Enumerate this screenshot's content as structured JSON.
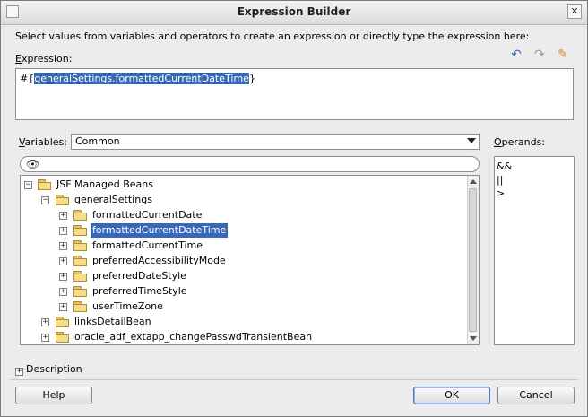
{
  "window": {
    "title": "Expression Builder"
  },
  "instructions": "Select values from variables and operators to create an expression or directly type the expression here:",
  "toolbar": {
    "undo_icon": "undo-icon",
    "redo_icon": "redo-icon",
    "clear_icon": "eraser-icon"
  },
  "expression": {
    "label_mnemonic": "E",
    "label_rest": "xpression:",
    "prefix": "#{",
    "selected": "generalSettings.formattedCurrentDateTime",
    "suffix": "}"
  },
  "variables": {
    "label_mnemonic": "V",
    "label_rest": "ariables:",
    "selected": "Common",
    "search_placeholder": "",
    "tree": [
      {
        "label": "JSF Managed Beans",
        "toggle": "−"
      },
      {
        "label": "generalSettings",
        "toggle": "−"
      },
      {
        "label": "formattedCurrentDate",
        "toggle": "+"
      },
      {
        "label": "formattedCurrentDateTime",
        "toggle": "+",
        "selected": true
      },
      {
        "label": "formattedCurrentTime",
        "toggle": "+"
      },
      {
        "label": "preferredAccessibilityMode",
        "toggle": "+"
      },
      {
        "label": "preferredDateStyle",
        "toggle": "+"
      },
      {
        "label": "preferredTimeStyle",
        "toggle": "+"
      },
      {
        "label": "userTimeZone",
        "toggle": "+"
      },
      {
        "label": "linksDetailBean",
        "toggle": "+"
      },
      {
        "label": "oracle_adf_extapp_changePasswdTransientBean",
        "toggle": "+"
      }
    ]
  },
  "operands": {
    "label_mnemonic": "O",
    "label_rest": "perands:",
    "items": [
      "&&",
      "||",
      ">"
    ]
  },
  "description": {
    "label": "Description",
    "toggle": "+"
  },
  "buttons": {
    "help": "Help",
    "ok": "OK",
    "cancel": "Cancel"
  }
}
